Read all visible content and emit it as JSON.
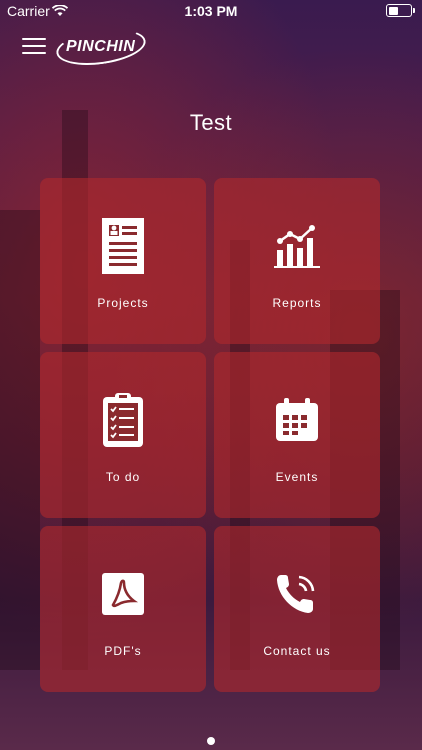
{
  "status_bar": {
    "carrier": "Carrier",
    "time": "1:03 PM"
  },
  "header": {
    "logo_text": "PINCHIN",
    "menu_icon": "hamburger-menu-icon"
  },
  "page": {
    "title": "Test"
  },
  "tiles": [
    {
      "label": "Projects",
      "icon": "document-icon"
    },
    {
      "label": "Reports",
      "icon": "chart-icon"
    },
    {
      "label": "To do",
      "icon": "clipboard-checklist-icon"
    },
    {
      "label": "Events",
      "icon": "calendar-icon"
    },
    {
      "label": "PDF's",
      "icon": "pdf-icon"
    },
    {
      "label": "Contact us",
      "icon": "phone-icon"
    }
  ],
  "pager": {
    "pages": 1,
    "current": 1
  }
}
